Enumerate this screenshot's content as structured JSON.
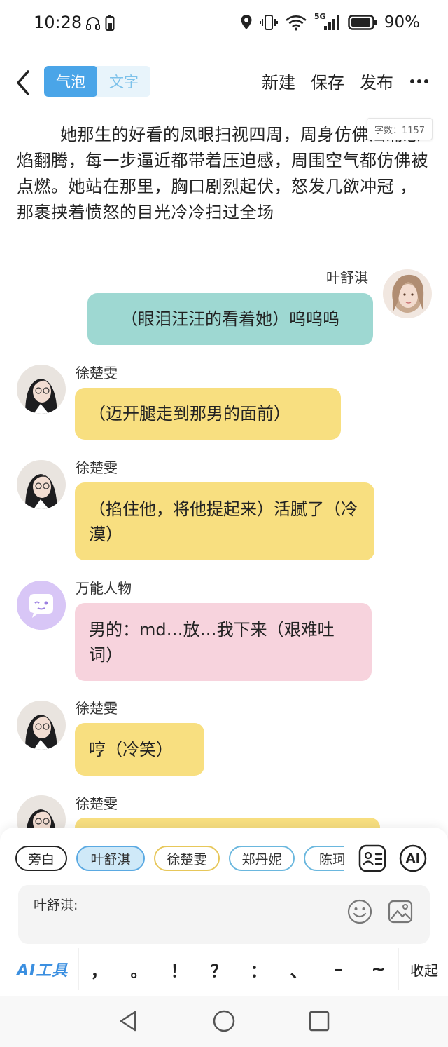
{
  "status_bar": {
    "time": "10:28",
    "battery": "90%",
    "network": "5G"
  },
  "top_bar": {
    "mode_tabs": [
      "气泡",
      "文字"
    ],
    "active_mode": "气泡",
    "actions": {
      "new": "新建",
      "save": "保存",
      "publish": "发布"
    }
  },
  "word_count": "字数：1157",
  "narration": "她那生的好看的凤眼扫视四周，周身仿佛汹涌怒焰翻腾，每一步逼近都带着压迫感，周围空气都仿佛被点燃。她站在那里，胸口剧烈起伏，怒发几欲冲冠 ，那裹挟着愤怒的目光冷冷扫过全场",
  "messages": [
    {
      "sender": "叶舒淇",
      "text": "（眼泪汪汪的看着她）呜呜呜",
      "color": "#9ed8d2",
      "side": "right"
    },
    {
      "sender": "徐楚雯",
      "text": "（迈开腿走到那男的面前）",
      "color": "#f8df80",
      "side": "left"
    },
    {
      "sender": "徐楚雯",
      "text": "（掐住他，将他提起来）活腻了（冷漠）",
      "color": "#f8df80",
      "side": "left"
    },
    {
      "sender": "万能人物",
      "text": "男的：md…放…我下来（艰难吐词）",
      "color": "#f7d3dd",
      "side": "left"
    },
    {
      "sender": "徐楚雯",
      "text": "哼（冷笑）",
      "color": "#f8df80",
      "side": "left"
    },
    {
      "sender": "徐楚雯",
      "text": "",
      "color": "#f8df80",
      "side": "left"
    }
  ],
  "bottom_panel": {
    "characters": [
      "旁白",
      "叶舒淇",
      "徐楚雯",
      "郑丹妮",
      "陈珂"
    ],
    "selected_character": "叶舒淇",
    "ai_button": "AI",
    "input_label": "叶舒淇:",
    "ai_tools": "AI工具",
    "punctuation": [
      "，",
      "。",
      "！",
      "？",
      "：",
      "、",
      "–",
      "~"
    ],
    "collapse": "收起"
  },
  "colors": {
    "accent": "#4aa5e8",
    "teal_bubble": "#9ed8d2",
    "yellow_bubble": "#f8df80",
    "pink_bubble": "#f7d3dd"
  }
}
